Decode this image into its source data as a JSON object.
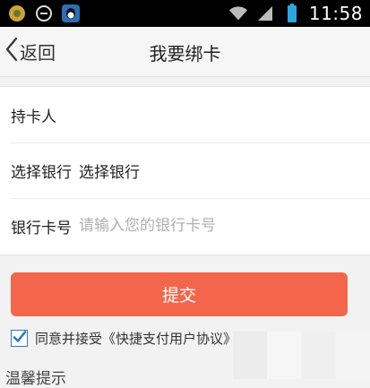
{
  "status_bar": {
    "time": "11:58",
    "icons": [
      "app-icon",
      "link-icon",
      "qq-icon",
      "wifi-icon",
      "signal-icon",
      "battery-icon"
    ]
  },
  "nav": {
    "back_label": "返回",
    "title": "我要绑卡"
  },
  "form": {
    "holder_label": "持卡人",
    "bank_label": "选择银行",
    "bank_value": "选择银行",
    "card_label": "银行卡号",
    "card_placeholder": "请输入您的银行卡号"
  },
  "submit_label": "提交",
  "agreement": {
    "checked": true,
    "text": "同意并接受《快捷支付用户协议》"
  },
  "tips_title": "温馨提示",
  "colors": {
    "accent": "#f4664c",
    "check": "#2b78c5"
  }
}
